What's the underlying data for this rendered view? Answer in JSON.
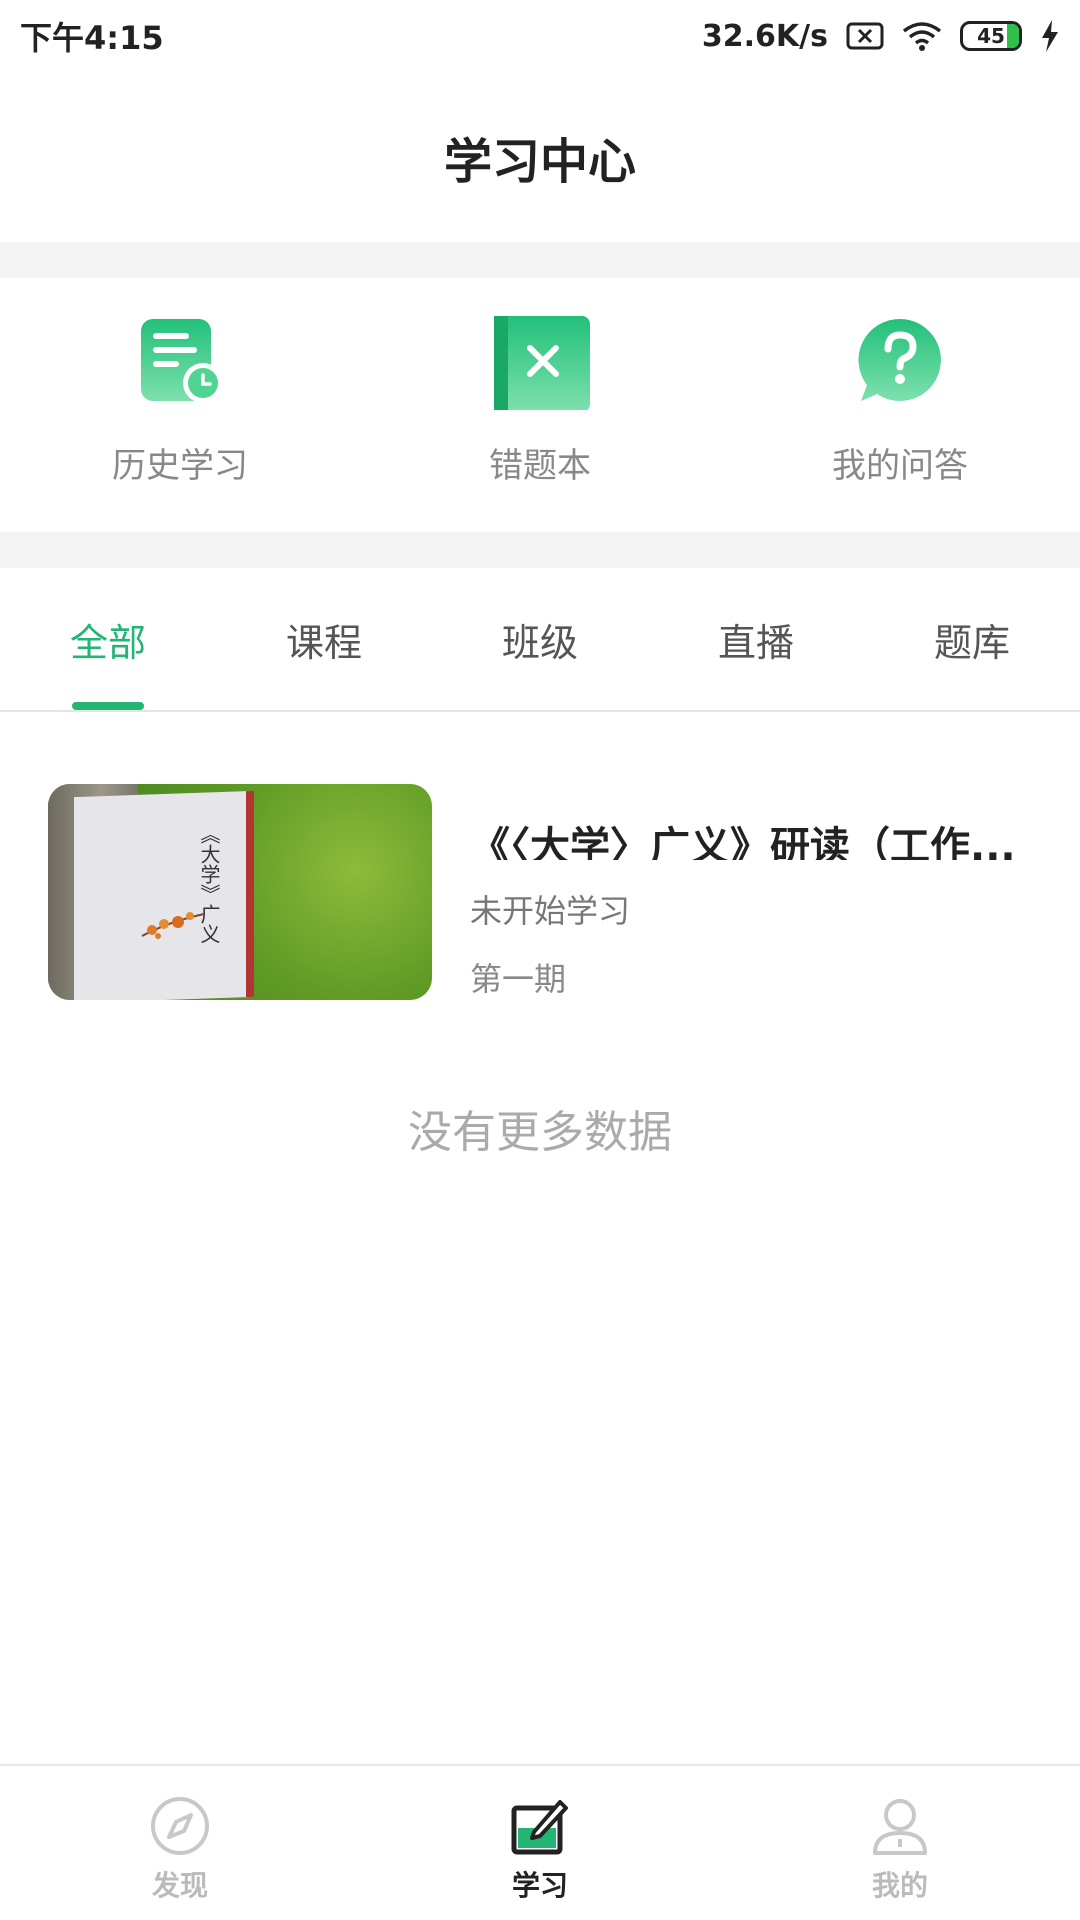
{
  "status_bar": {
    "time": "下午4:15",
    "speed": "32.6K/s",
    "battery": "45"
  },
  "header": {
    "title": "学习中心"
  },
  "quick_actions": [
    {
      "label": "历史学习",
      "icon": "history-doc-icon"
    },
    {
      "label": "错题本",
      "icon": "wrong-book-icon"
    },
    {
      "label": "我的问答",
      "icon": "question-bubble-icon"
    }
  ],
  "tabs": [
    {
      "label": "全部",
      "active": true
    },
    {
      "label": "课程",
      "active": false
    },
    {
      "label": "班级",
      "active": false
    },
    {
      "label": "直播",
      "active": false
    },
    {
      "label": "题库",
      "active": false
    }
  ],
  "course": {
    "title": "《〈大学〉广义》研读（工作...",
    "status": "未开始学习",
    "period": "第一期",
    "cover_text": "《大学》广义"
  },
  "footer_note": "没有更多数据",
  "bottom_nav": [
    {
      "label": "发现",
      "icon": "compass-icon",
      "active": false
    },
    {
      "label": "学习",
      "icon": "study-icon",
      "active": true
    },
    {
      "label": "我的",
      "icon": "user-icon",
      "active": false
    }
  ],
  "colors": {
    "accent": "#22b573",
    "text": "#222222",
    "muted": "#888888"
  }
}
